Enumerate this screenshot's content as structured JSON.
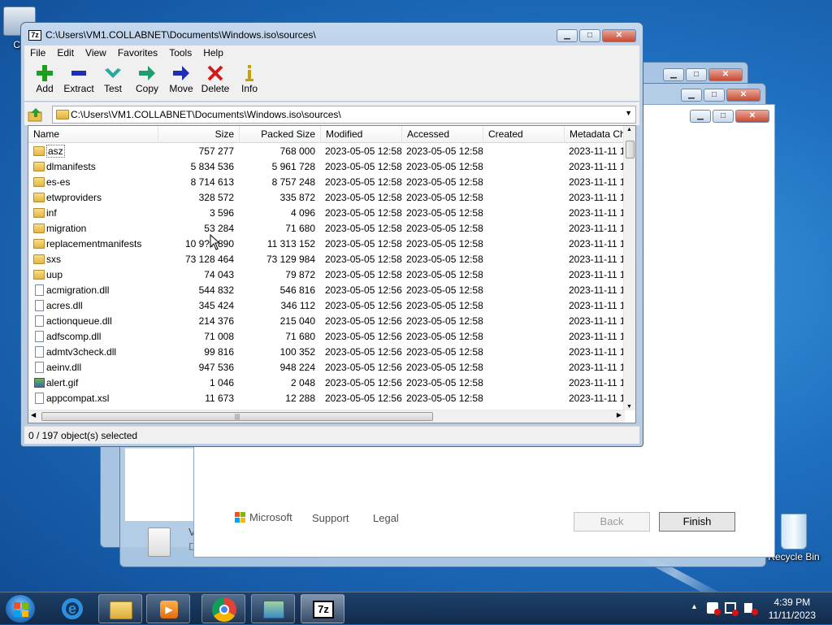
{
  "desktop": {
    "icons": [
      {
        "label": "Co"
      },
      {
        "label": "Recycle Bin"
      }
    ]
  },
  "window": {
    "title": "C:\\Users\\VM1.COLLABNET\\Documents\\Windows.iso\\sources\\",
    "app_icon": "7z"
  },
  "menu": [
    "File",
    "Edit",
    "View",
    "Favorites",
    "Tools",
    "Help"
  ],
  "toolbar": [
    {
      "label": "Add",
      "icon": "plus-icon",
      "color": "#1e9e1e"
    },
    {
      "label": "Extract",
      "icon": "minus-icon",
      "color": "#1f2fb3"
    },
    {
      "label": "Test",
      "icon": "check-icon",
      "color": "#2aa7a0"
    },
    {
      "label": "Copy",
      "icon": "arrow-right-icon",
      "color": "#1e9e6e"
    },
    {
      "label": "Move",
      "icon": "arrow-right-icon",
      "color": "#1f2fb3"
    },
    {
      "label": "Delete",
      "icon": "x-icon",
      "color": "#d21c1c"
    },
    {
      "label": "Info",
      "icon": "info-icon",
      "color": "#c8a000"
    }
  ],
  "address": {
    "path": "C:\\Users\\VM1.COLLABNET\\Documents\\Windows.iso\\sources\\"
  },
  "columns": [
    "Name",
    "Size",
    "Packed Size",
    "Modified",
    "Accessed",
    "Created",
    "Metadata Ch"
  ],
  "rows": [
    {
      "type": "folder",
      "name": "asz",
      "size": "757 277",
      "packed": "768 000",
      "modified": "2023-05-05 12:58",
      "accessed": "2023-05-05 12:58",
      "created": "",
      "meta": "2023-11-11 1"
    },
    {
      "type": "folder",
      "name": "dlmanifests",
      "size": "5 834 536",
      "packed": "5 961 728",
      "modified": "2023-05-05 12:58",
      "accessed": "2023-05-05 12:58",
      "created": "",
      "meta": "2023-11-11 1"
    },
    {
      "type": "folder",
      "name": "es-es",
      "size": "8 714 613",
      "packed": "8 757 248",
      "modified": "2023-05-05 12:58",
      "accessed": "2023-05-05 12:58",
      "created": "",
      "meta": "2023-11-11 1"
    },
    {
      "type": "folder",
      "name": "etwproviders",
      "size": "328 572",
      "packed": "335 872",
      "modified": "2023-05-05 12:58",
      "accessed": "2023-05-05 12:58",
      "created": "",
      "meta": "2023-11-11 1"
    },
    {
      "type": "folder",
      "name": "inf",
      "size": "3 596",
      "packed": "4 096",
      "modified": "2023-05-05 12:58",
      "accessed": "2023-05-05 12:58",
      "created": "",
      "meta": "2023-11-11 1"
    },
    {
      "type": "folder",
      "name": "migration",
      "size": "53 284",
      "packed": "71 680",
      "modified": "2023-05-05 12:58",
      "accessed": "2023-05-05 12:58",
      "created": "",
      "meta": "2023-11-11 1"
    },
    {
      "type": "folder",
      "name": "replacementmanifests",
      "size": "10 9?? 890",
      "packed": "11 313 152",
      "modified": "2023-05-05 12:58",
      "accessed": "2023-05-05 12:58",
      "created": "",
      "meta": "2023-11-11 1"
    },
    {
      "type": "folder",
      "name": "sxs",
      "size": "73 128 464",
      "packed": "73 129 984",
      "modified": "2023-05-05 12:58",
      "accessed": "2023-05-05 12:58",
      "created": "",
      "meta": "2023-11-11 1"
    },
    {
      "type": "folder",
      "name": "uup",
      "size": "74 043",
      "packed": "79 872",
      "modified": "2023-05-05 12:58",
      "accessed": "2023-05-05 12:58",
      "created": "",
      "meta": "2023-11-11 1"
    },
    {
      "type": "file",
      "name": "acmigration.dll",
      "size": "544 832",
      "packed": "546 816",
      "modified": "2023-05-05 12:56",
      "accessed": "2023-05-05 12:58",
      "created": "",
      "meta": "2023-11-11 1"
    },
    {
      "type": "file",
      "name": "acres.dll",
      "size": "345 424",
      "packed": "346 112",
      "modified": "2023-05-05 12:56",
      "accessed": "2023-05-05 12:58",
      "created": "",
      "meta": "2023-11-11 1"
    },
    {
      "type": "file",
      "name": "actionqueue.dll",
      "size": "214 376",
      "packed": "215 040",
      "modified": "2023-05-05 12:56",
      "accessed": "2023-05-05 12:58",
      "created": "",
      "meta": "2023-11-11 1"
    },
    {
      "type": "file",
      "name": "adfscomp.dll",
      "size": "71 008",
      "packed": "71 680",
      "modified": "2023-05-05 12:56",
      "accessed": "2023-05-05 12:58",
      "created": "",
      "meta": "2023-11-11 1"
    },
    {
      "type": "file",
      "name": "admtv3check.dll",
      "size": "99 816",
      "packed": "100 352",
      "modified": "2023-05-05 12:56",
      "accessed": "2023-05-05 12:58",
      "created": "",
      "meta": "2023-11-11 1"
    },
    {
      "type": "file",
      "name": "aeinv.dll",
      "size": "947 536",
      "packed": "948 224",
      "modified": "2023-05-05 12:56",
      "accessed": "2023-05-05 12:58",
      "created": "",
      "meta": "2023-11-11 1"
    },
    {
      "type": "image",
      "name": "alert.gif",
      "size": "1 046",
      "packed": "2 048",
      "modified": "2023-05-05 12:56",
      "accessed": "2023-05-05 12:58",
      "created": "",
      "meta": "2023-11-11 1"
    },
    {
      "type": "file",
      "name": "appcompat.xsl",
      "size": "11 673",
      "packed": "12 288",
      "modified": "2023-05-05 12:56",
      "accessed": "2023-05-05 12:58",
      "created": "",
      "meta": "2023-11-11 1"
    }
  ],
  "status": "0 / 197 object(s) selected",
  "installer": {
    "brand": "Microsoft",
    "support": "Support",
    "legal": "Legal",
    "back": "Back",
    "finish": "Finish",
    "side_letters": [
      "V",
      "D"
    ]
  },
  "taskbar": {
    "time": "4:39 PM",
    "date": "11/11/2023",
    "apps": [
      "internet-explorer",
      "file-explorer",
      "media-player",
      "chrome",
      "setup",
      "7-zip"
    ]
  }
}
